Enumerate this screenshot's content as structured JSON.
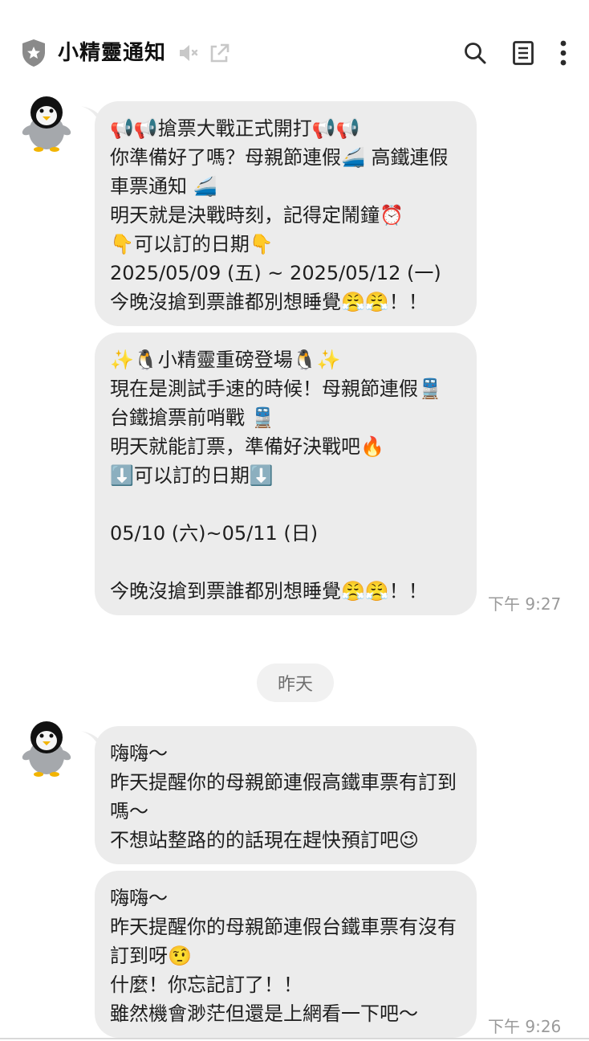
{
  "header": {
    "title": "小精靈通知",
    "icons": {
      "badge": "shield-star-icon",
      "mute": "speaker-muted-icon",
      "share": "external-link-icon",
      "search": "search-icon",
      "notes": "notes-icon",
      "more": "more-vertical-icon"
    }
  },
  "messages": [
    {
      "text": "📢📢搶票大戰正式開打📢📢\n你準備好了嗎？母親節連假🚄 高鐵連假車票通知 🚄\n明天就是決戰時刻，記得定鬧鐘⏰\n👇可以訂的日期👇\n2025/05/09 (五) ~ 2025/05/12 (一)\n今晚沒搶到票誰都別想睡覺😤😤！！"
    },
    {
      "text": "✨🐧小精靈重磅登場🐧✨\n現在是測試手速的時候！母親節連假🚆 台鐵搶票前哨戰 🚆\n明天就能訂票，準備好決戰吧🔥\n⬇️可以訂的日期⬇️\n\n05/10 (六)~05/11 (日)\n\n今晚沒搶到票誰都別想睡覺😤😤！！",
      "time": "下午 9:27"
    },
    {
      "text": "嗨嗨～\n昨天提醒你的母親節連假高鐵車票有訂到嗎～\n不想站整路的的話現在趕快預訂吧😉"
    },
    {
      "text": "嗨嗨～\n昨天提醒你的母親節連假台鐵車票有沒有訂到呀🤨\n什麼！你忘記訂了！！\n雖然機會渺茫但還是上網看一下吧～",
      "time": "下午 9:26"
    }
  ],
  "date_separator": "昨天",
  "colors": {
    "bubble": "#ececec",
    "timestamp": "#9a9a9a",
    "icon": "#2b2b2b",
    "muted_icon": "#c8c8c8"
  }
}
